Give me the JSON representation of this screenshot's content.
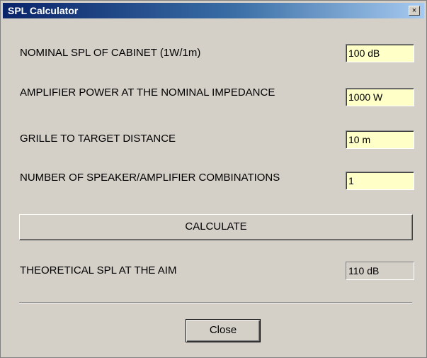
{
  "window": {
    "title": "SPL Calculator",
    "close_glyph": "×"
  },
  "form": {
    "nominal_spl_label": "NOMINAL SPL OF CABINET (1W/1m)",
    "nominal_spl_value": "100 dB",
    "amp_power_label": "AMPLIFIER POWER AT THE NOMINAL IMPEDANCE",
    "amp_power_value": "1000 W",
    "distance_label": "GRILLE TO TARGET DISTANCE",
    "distance_value": "10 m",
    "combinations_label": "NUMBER OF SPEAKER/AMPLIFIER COMBINATIONS",
    "combinations_value": "1"
  },
  "actions": {
    "calculate_label": "CALCULATE",
    "close_label": "Close"
  },
  "result": {
    "label": "THEORETICAL SPL  AT THE AIM",
    "value": "110 dB"
  },
  "colors": {
    "titlebar_start": "#0a246a",
    "titlebar_end": "#a6caf0",
    "dialog_background": "#d4d0c8",
    "editable_field_background": "#ffffc8"
  }
}
